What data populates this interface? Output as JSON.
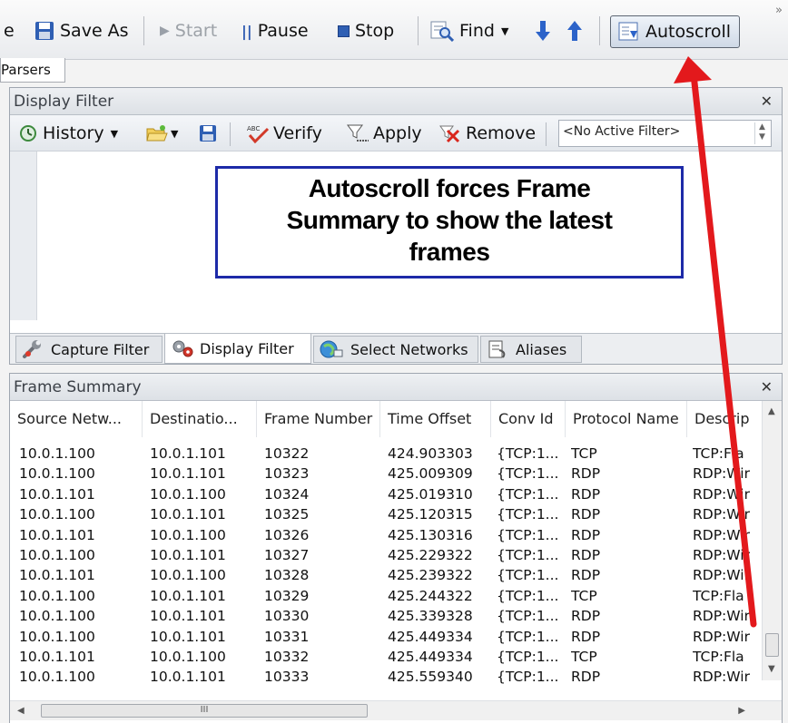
{
  "toolbar": {
    "partial_label": "e",
    "save_as": "Save As",
    "start": "Start",
    "pause": "Pause",
    "stop": "Stop",
    "find": "Find",
    "autoscroll": "Autoscroll",
    "overflow": "»"
  },
  "tabs": {
    "parsers": "Parsers"
  },
  "display_filter": {
    "title": "Display Filter",
    "history": "History",
    "verify": "Verify",
    "apply": "Apply",
    "remove": "Remove",
    "active_filter": "<No Active Filter>"
  },
  "callout": {
    "line1": "Autoscroll forces Frame",
    "line2": "Summary to show the latest",
    "line3": "frames"
  },
  "bottom_tabs": [
    "Capture Filter",
    "Display Filter",
    "Select Networks",
    "Aliases"
  ],
  "frame_summary": {
    "title": "Frame Summary",
    "columns": [
      "Source Netw...",
      "Destinatio...",
      "Frame Number",
      "Time Offset",
      "Conv Id",
      "Protocol Name",
      "Descrip"
    ],
    "rows": [
      [
        "10.0.1.100",
        "10.0.1.101",
        "10322",
        "424.903303",
        "{TCP:1...",
        "TCP",
        "TCP:Fla"
      ],
      [
        "10.0.1.100",
        "10.0.1.101",
        "10323",
        "425.009309",
        "{TCP:1...",
        "RDP",
        "RDP:Wir"
      ],
      [
        "10.0.1.101",
        "10.0.1.100",
        "10324",
        "425.019310",
        "{TCP:1...",
        "RDP",
        "RDP:Wir"
      ],
      [
        "10.0.1.100",
        "10.0.1.101",
        "10325",
        "425.120315",
        "{TCP:1...",
        "RDP",
        "RDP:Wir"
      ],
      [
        "10.0.1.101",
        "10.0.1.100",
        "10326",
        "425.130316",
        "{TCP:1...",
        "RDP",
        "RDP:Wir"
      ],
      [
        "10.0.1.100",
        "10.0.1.101",
        "10327",
        "425.229322",
        "{TCP:1...",
        "RDP",
        "RDP:Wir"
      ],
      [
        "10.0.1.101",
        "10.0.1.100",
        "10328",
        "425.239322",
        "{TCP:1...",
        "RDP",
        "RDP:Wir"
      ],
      [
        "10.0.1.100",
        "10.0.1.101",
        "10329",
        "425.244322",
        "{TCP:1...",
        "TCP",
        "TCP:Fla"
      ],
      [
        "10.0.1.100",
        "10.0.1.101",
        "10330",
        "425.339328",
        "{TCP:1...",
        "RDP",
        "RDP:Wir"
      ],
      [
        "10.0.1.100",
        "10.0.1.101",
        "10331",
        "425.449334",
        "{TCP:1...",
        "RDP",
        "RDP:Wir"
      ],
      [
        "10.0.1.101",
        "10.0.1.100",
        "10332",
        "425.449334",
        "{TCP:1...",
        "TCP",
        "TCP:Fla"
      ],
      [
        "10.0.1.100",
        "10.0.1.101",
        "10333",
        "425.559340",
        "{TCP:1...",
        "RDP",
        "RDP:Wir"
      ]
    ],
    "hscroll_grip": "III"
  },
  "colors": {
    "annotation_arrow": "#e3191c",
    "callout_border": "#1d2aa8"
  }
}
